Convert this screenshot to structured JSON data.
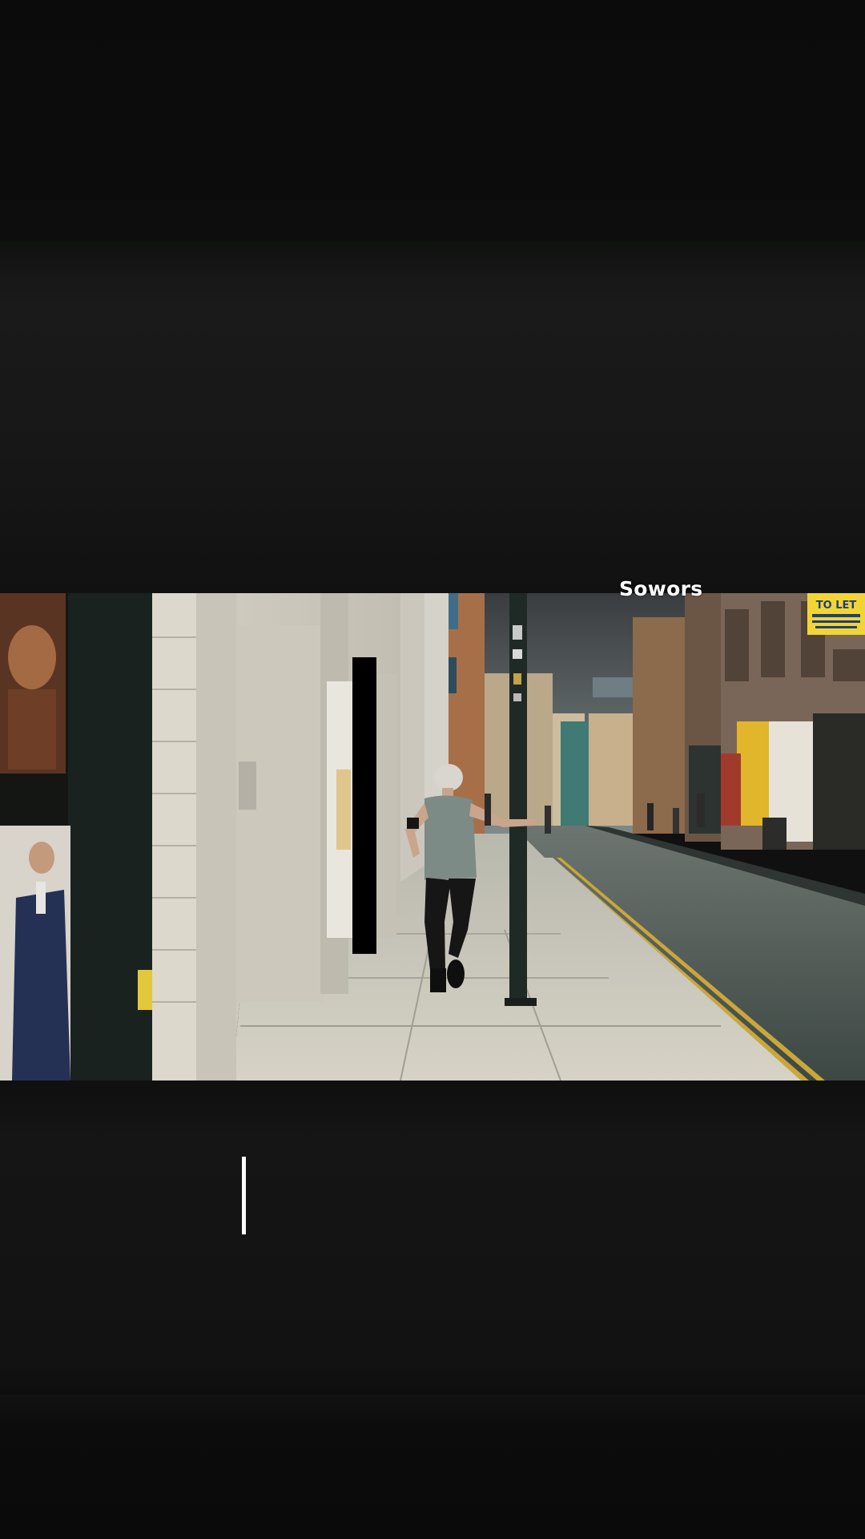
{
  "overlay": {
    "caption_text": "Sowors"
  },
  "scene": {
    "signs": {
      "to_let": "TO LET"
    }
  },
  "colors": {
    "background": "#0c0c0c",
    "caption": "#ffffff",
    "cursor": "#ffffff",
    "road_line": "#c9a73a"
  }
}
